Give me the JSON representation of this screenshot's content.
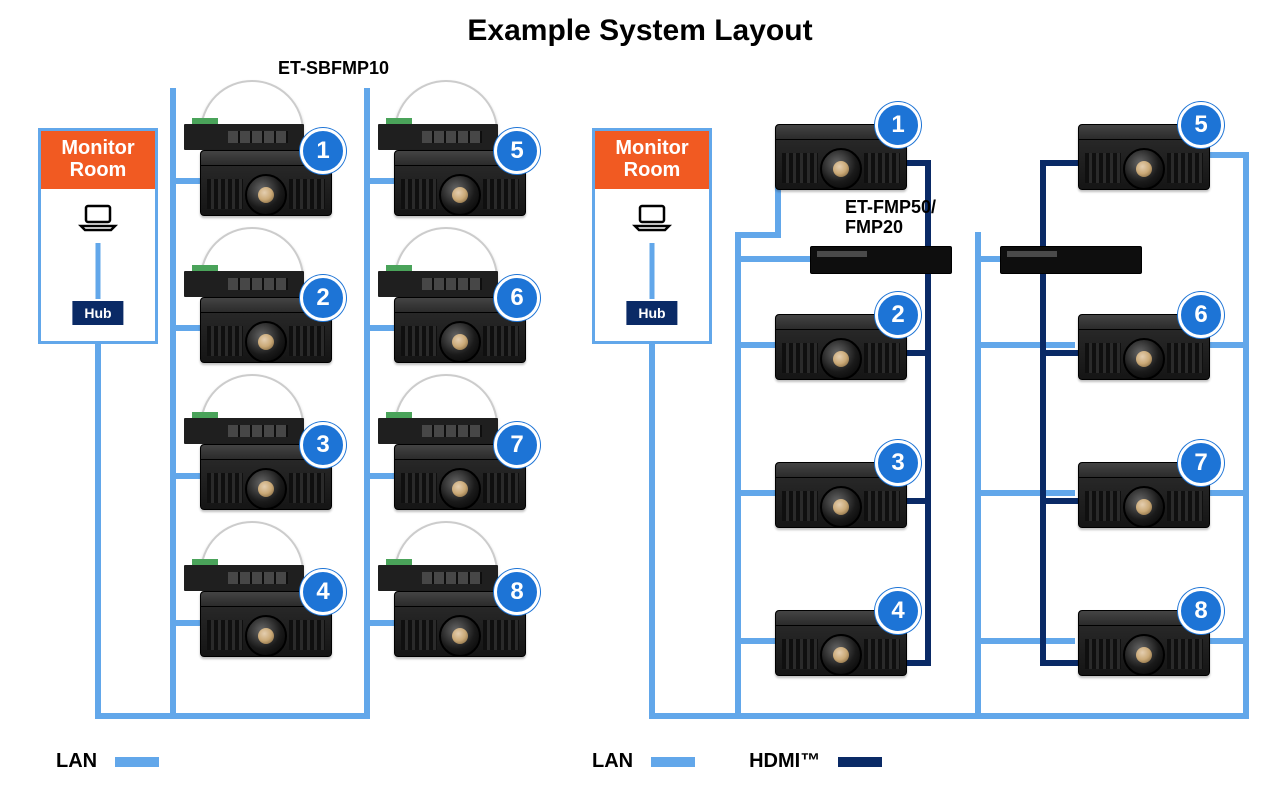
{
  "title": "Example System Layout",
  "monitor_room_label_line1": "Monitor",
  "monitor_room_label_line2": "Room",
  "hub_label": "Hub",
  "board_model": "ET-SBFMP10",
  "fmp_label_line1": "ET-FMP50/",
  "fmp_label_line2": "FMP20",
  "legend": {
    "lan": "LAN",
    "hdmi": "HDMI™"
  },
  "colors": {
    "lan": "#62a7ea",
    "hdmi": "#0a2a66",
    "accent_orange": "#f15a22",
    "badge_blue": "#1d74d6"
  },
  "left": {
    "projectors": [
      1,
      2,
      3,
      4,
      5,
      6,
      7,
      8
    ]
  },
  "right": {
    "projectors": [
      1,
      2,
      3,
      4,
      5,
      6,
      7,
      8
    ]
  }
}
